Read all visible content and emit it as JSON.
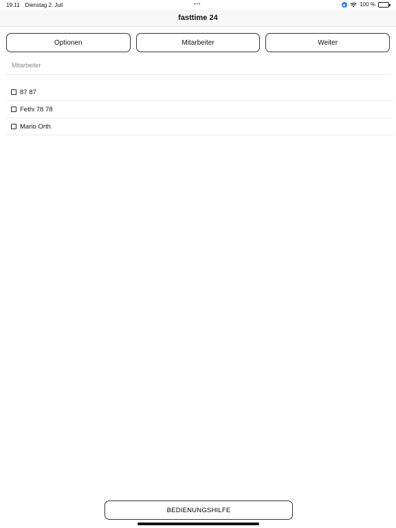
{
  "status_bar": {
    "time": "19:11",
    "date": "Dienstag 2. Juli",
    "battery": "100 %",
    "icons": [
      "location-icon",
      "wifi-icon",
      "battery-icon"
    ]
  },
  "nav": {
    "title": "fasttime 24"
  },
  "top_buttons": {
    "options": "Optionen",
    "employees": "Mitarbeiter",
    "next": "Weiter"
  },
  "section": {
    "label": "Mitarbeiter"
  },
  "employees": [
    {
      "name": "87 87",
      "checked": false
    },
    {
      "name": "Fethi 78 78",
      "checked": false
    },
    {
      "name": "Mario Orth",
      "checked": false
    }
  ],
  "help_button": {
    "label": "BEDIENUNGSHILFE"
  },
  "colors": {
    "location_blue": "#1c7cf2",
    "nav_background": "#f8f8f8"
  }
}
